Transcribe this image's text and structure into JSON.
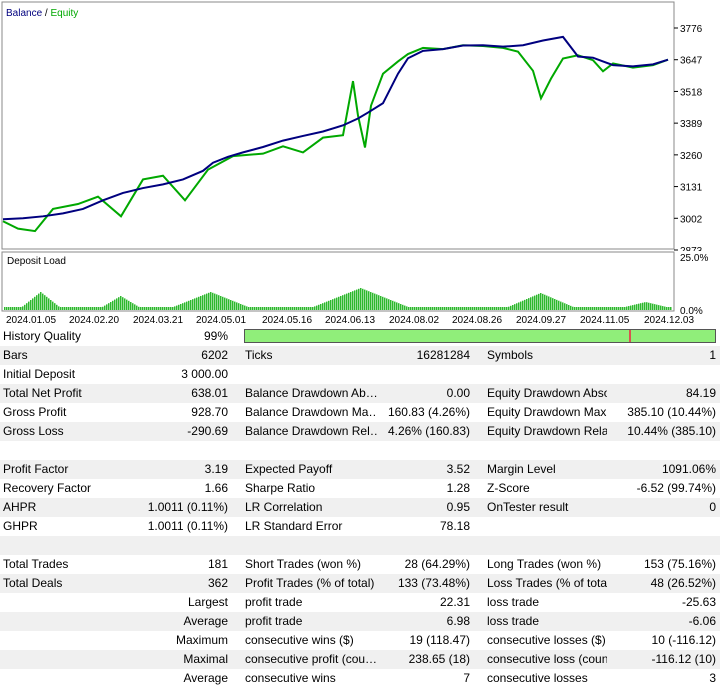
{
  "chart": {
    "legend_balance": "Balance",
    "legend_sep": " / ",
    "legend_equity": "Equity",
    "balance_color": "#00007f",
    "equity_color": "#00a800",
    "load_color": "#2db82d",
    "y_ticks": [
      "3776",
      "3647",
      "3518",
      "3389",
      "3260",
      "3131",
      "3002",
      "2873"
    ],
    "x_ticks": [
      "2024.01.05",
      "2024.02.20",
      "2024.03.21",
      "2024.05.01",
      "2024.05.16",
      "2024.06.13",
      "2024.08.02",
      "2024.08.26",
      "2024.09.27",
      "2024.11.05",
      "2024.12.03"
    ],
    "load_title": "Deposit Load",
    "load_top": "25.0%",
    "load_bottom": "0.0%"
  },
  "chart_data": {
    "type": "line",
    "ylim": [
      2873,
      3776
    ],
    "series": [
      {
        "name": "Balance",
        "x": [
          0,
          20,
          40,
          60,
          80,
          100,
          120,
          140,
          160,
          180,
          200,
          210,
          225,
          240,
          260,
          280,
          300,
          320,
          340,
          355,
          365,
          380,
          395,
          405,
          420,
          440,
          460,
          480,
          500,
          520,
          540,
          560,
          575,
          590,
          600,
          610,
          630,
          650,
          665
        ],
        "y": [
          2998,
          3002,
          3010,
          3022,
          3040,
          3075,
          3105,
          3125,
          3140,
          3160,
          3195,
          3228,
          3252,
          3270,
          3292,
          3318,
          3337,
          3355,
          3380,
          3408,
          3432,
          3470,
          3590,
          3653,
          3683,
          3690,
          3705,
          3706,
          3700,
          3706,
          3725,
          3740,
          3660,
          3655,
          3640,
          3625,
          3620,
          3628,
          3647
        ]
      },
      {
        "name": "Equity",
        "x": [
          0,
          15,
          32,
          50,
          75,
          95,
          118,
          140,
          160,
          182,
          205,
          230,
          260,
          280,
          300,
          320,
          340,
          350,
          355,
          362,
          368,
          380,
          395,
          405,
          420,
          440,
          460,
          480,
          500,
          515,
          530,
          538,
          548,
          560,
          575,
          590,
          600,
          610,
          630,
          650,
          665
        ],
        "y": [
          2990,
          2960,
          2950,
          3040,
          3060,
          3090,
          3010,
          3160,
          3175,
          3075,
          3200,
          3255,
          3265,
          3295,
          3270,
          3330,
          3340,
          3560,
          3420,
          3290,
          3460,
          3590,
          3640,
          3670,
          3695,
          3690,
          3706,
          3703,
          3695,
          3680,
          3602,
          3490,
          3570,
          3652,
          3665,
          3645,
          3600,
          3632,
          3615,
          3625,
          3647
        ]
      }
    ]
  },
  "report": {
    "rows": [
      {
        "cells": [
          "History Quality",
          "99%",
          "",
          "",
          "",
          ""
        ],
        "bar": true
      },
      {
        "cells": [
          "Bars",
          "6202",
          "Ticks",
          "16281284",
          "Symbols",
          "1"
        ]
      },
      {
        "cells": [
          "Initial Deposit",
          "3 000.00",
          "",
          "",
          "",
          ""
        ]
      },
      {
        "cells": [
          "Total Net Profit",
          "638.01",
          "Balance Drawdown Ab…",
          "0.00",
          "Equity Drawdown Abso…",
          "84.19"
        ]
      },
      {
        "cells": [
          "Gross Profit",
          "928.70",
          "Balance Drawdown Ma…",
          "160.83 (4.26%)",
          "Equity Drawdown Maxi…",
          "385.10 (10.44%)"
        ]
      },
      {
        "cells": [
          "Gross Loss",
          "-290.69",
          "Balance Drawdown Rel…",
          "4.26% (160.83)",
          "Equity Drawdown Relat…",
          "10.44% (385.10)"
        ]
      },
      {
        "cells": [
          "",
          "",
          "",
          "",
          "",
          ""
        ]
      },
      {
        "cells": [
          "Profit Factor",
          "3.19",
          "Expected Payoff",
          "3.52",
          "Margin Level",
          "1091.06%"
        ]
      },
      {
        "cells": [
          "Recovery Factor",
          "1.66",
          "Sharpe Ratio",
          "1.28",
          "Z-Score",
          "-6.52 (99.74%)"
        ]
      },
      {
        "cells": [
          "AHPR",
          "1.0011 (0.11%)",
          "LR Correlation",
          "0.95",
          "OnTester result",
          "0"
        ]
      },
      {
        "cells": [
          "GHPR",
          "1.0011 (0.11%)",
          "LR Standard Error",
          "78.18",
          "",
          ""
        ]
      },
      {
        "cells": [
          "",
          "",
          "",
          "",
          "",
          ""
        ]
      },
      {
        "cells": [
          "Total Trades",
          "181",
          "Short Trades (won %)",
          "28 (64.29%)",
          "Long Trades (won %)",
          "153 (75.16%)"
        ]
      },
      {
        "cells": [
          "Total Deals",
          "362",
          "Profit Trades (% of total)",
          "133 (73.48%)",
          "Loss Trades (% of total)",
          "48 (26.52%)"
        ]
      },
      {
        "cells": [
          "Largest",
          "",
          "profit trade",
          "22.31",
          "loss trade",
          "-25.63"
        ],
        "rightlabel": true
      },
      {
        "cells": [
          "Average",
          "",
          "profit trade",
          "6.98",
          "loss trade",
          "-6.06"
        ],
        "rightlabel": true
      },
      {
        "cells": [
          "Maximum",
          "",
          "consecutive wins ($)",
          "19 (118.47)",
          "consecutive losses ($)",
          "10 (-116.12)"
        ],
        "rightlabel": true
      },
      {
        "cells": [
          "Maximal",
          "",
          "consecutive profit (cou…",
          "238.65 (18)",
          "consecutive loss (count)",
          "-116.12 (10)"
        ],
        "rightlabel": true
      },
      {
        "cells": [
          "Average",
          "",
          "consecutive wins",
          "7",
          "consecutive losses",
          "3"
        ],
        "rightlabel": true
      }
    ]
  }
}
